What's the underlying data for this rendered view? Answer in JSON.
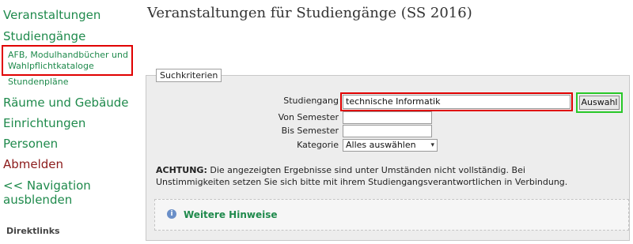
{
  "sidebar": {
    "items": [
      {
        "label": "Veranstaltungen"
      },
      {
        "label": "Studiengänge"
      },
      {
        "label": "AFB, Modulhandbücher und"
      },
      {
        "label": "Wahlpflichtkataloge"
      },
      {
        "label": "Stundenpläne"
      },
      {
        "label": "Räume und Gebäude"
      },
      {
        "label": "Einrichtungen"
      },
      {
        "label": "Personen"
      },
      {
        "label": "Abmelden"
      },
      {
        "label": "<< Navigation"
      },
      {
        "label": "ausblenden"
      }
    ],
    "direktlinks": "Direktlinks"
  },
  "main": {
    "title": "Veranstaltungen für Studiengänge (SS 2016)",
    "legend": "Suchkriterien",
    "form": {
      "studiengang_label": "Studiengang",
      "studiengang_value": "technische Informatik",
      "von_label": "Von Semester",
      "von_value": "",
      "bis_label": "Bis Semester",
      "bis_value": "",
      "kategorie_label": "Kategorie",
      "kategorie_value": "Alles auswählen",
      "submit_label": "Auswahl"
    },
    "note_bold": "ACHTUNG:",
    "note_line1": " Die angezeigten Ergebnisse sind unter Umständen nicht vollständig. Bei",
    "note_line2": "Unstimmigkeiten setzen Sie sich bitte mit ihrem Studiengangsverantwortlichen in Verbindung.",
    "hinweise": "Weitere Hinweise"
  },
  "colors": {
    "link_green": "#1f8a4c",
    "logout_red": "#8b1a1a",
    "highlight_red": "#e00000",
    "highlight_green": "#28c828"
  }
}
